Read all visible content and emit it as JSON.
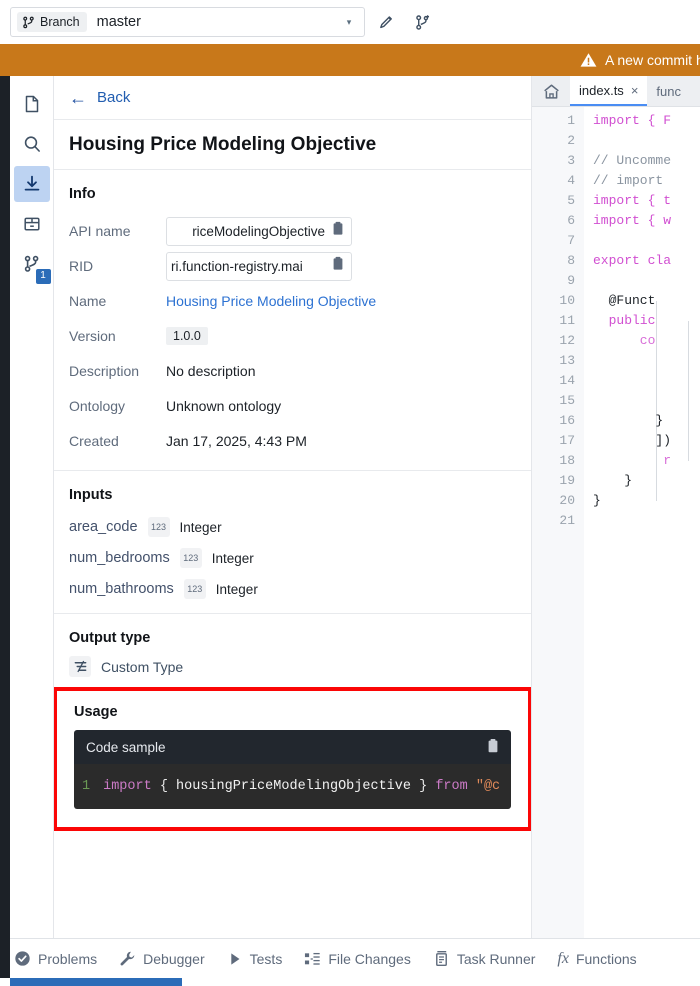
{
  "branch_bar": {
    "chip_label": "Branch",
    "branch_name": "master",
    "caret": "▾",
    "edit_icon": "pencil-icon",
    "new_branch_icon": "branch-plus-icon"
  },
  "banner": {
    "text": "A new commit has be",
    "icon": "warning-icon",
    "color": "#c8781a"
  },
  "sidebar": {
    "items": [
      {
        "name": "files-icon",
        "label": "Files",
        "active": false,
        "badge": ""
      },
      {
        "name": "search-icon",
        "label": "Search",
        "active": false,
        "badge": ""
      },
      {
        "name": "install-icon",
        "label": "Install",
        "active": true,
        "badge": ""
      },
      {
        "name": "package-icon",
        "label": "Package",
        "active": false,
        "badge": ""
      },
      {
        "name": "branches-icon",
        "label": "Branches",
        "active": false,
        "badge": "1"
      }
    ]
  },
  "detail": {
    "back_label": "Back",
    "title": "Housing Price Modeling Objective",
    "info": {
      "heading": "Info",
      "rows": [
        {
          "label": "API name",
          "value": "PriceModelingObjective",
          "type": "copy",
          "display": "riceModelingObjective"
        },
        {
          "label": "RID",
          "value": "ri.function-registry.mai",
          "type": "copy",
          "display": "ri.function-registry.mai"
        },
        {
          "label": "Name",
          "value": "Housing Price Modeling Objective",
          "type": "link"
        },
        {
          "label": "Version",
          "value": "1.0.0",
          "type": "tag"
        },
        {
          "label": "Description",
          "value": "No description",
          "type": "text"
        },
        {
          "label": "Ontology",
          "value": "Unknown ontology",
          "type": "text"
        },
        {
          "label": "Created",
          "value": "Jan 17, 2025, 4:43 PM",
          "type": "text"
        }
      ]
    },
    "inputs": {
      "heading": "Inputs",
      "rows": [
        {
          "name": "area_code",
          "type_icon": "123",
          "type": "Integer"
        },
        {
          "name": "num_bedrooms",
          "type_icon": "123",
          "type": "Integer"
        },
        {
          "name": "num_bathrooms",
          "type_icon": "123",
          "type": "Integer"
        }
      ]
    },
    "output": {
      "heading": "Output type",
      "icon": "custom-type-icon",
      "value": "Custom Type"
    },
    "usage": {
      "heading": "Usage",
      "code_sample_label": "Code sample",
      "copy_icon": "clipboard-icon",
      "line_number": "1",
      "code": {
        "kw_import": "import",
        "brace_open": "{",
        "identifier": "housingPriceModelingObjective",
        "brace_close": "}",
        "kw_from": "from",
        "string": "\"@c"
      },
      "highlight_color": "#fb0606"
    }
  },
  "editor": {
    "home_icon": "home-icon",
    "tabs": [
      {
        "label": "index.ts",
        "active": true,
        "close": "×"
      },
      {
        "label": "func",
        "active": false,
        "close": ""
      }
    ],
    "lines": [
      {
        "n": "1",
        "segments": [
          {
            "t": "import { F",
            "c": "kw"
          }
        ]
      },
      {
        "n": "2",
        "segments": []
      },
      {
        "n": "3",
        "segments": [
          {
            "t": "// Uncomme",
            "c": "cm"
          }
        ]
      },
      {
        "n": "4",
        "segments": [
          {
            "t": "// import",
            "c": "cm"
          }
        ]
      },
      {
        "n": "5",
        "segments": [
          {
            "t": "import { t",
            "c": "kw"
          }
        ]
      },
      {
        "n": "6",
        "segments": [
          {
            "t": "import { w",
            "c": "kw"
          }
        ]
      },
      {
        "n": "7",
        "segments": []
      },
      {
        "n": "8",
        "segments": [
          {
            "t": "export cla",
            "c": "kw"
          }
        ]
      },
      {
        "n": "9",
        "segments": []
      },
      {
        "n": "10",
        "segments": [
          {
            "t": "  @Funct",
            "c": "pl"
          }
        ]
      },
      {
        "n": "11",
        "segments": [
          {
            "t": "  public",
            "c": "kw"
          }
        ]
      },
      {
        "n": "12",
        "segments": [
          {
            "t": "      co",
            "c": "mg"
          }
        ]
      },
      {
        "n": "13",
        "segments": []
      },
      {
        "n": "14",
        "segments": []
      },
      {
        "n": "15",
        "segments": []
      },
      {
        "n": "16",
        "segments": [
          {
            "t": "        }",
            "c": "pl"
          }
        ]
      },
      {
        "n": "17",
        "segments": [
          {
            "t": "        ])",
            "c": "pl"
          }
        ]
      },
      {
        "n": "18",
        "segments": [
          {
            "t": "         r",
            "c": "mg"
          }
        ]
      },
      {
        "n": "19",
        "segments": [
          {
            "t": "    }",
            "c": "pl"
          }
        ]
      },
      {
        "n": "20",
        "segments": [
          {
            "t": "}",
            "c": "pl"
          }
        ]
      },
      {
        "n": "21",
        "segments": []
      }
    ]
  },
  "statusbar": {
    "items": [
      {
        "icon": "check-circle-icon",
        "label": "Problems"
      },
      {
        "icon": "wrench-icon",
        "label": "Debugger"
      },
      {
        "icon": "play-icon",
        "label": "Tests"
      },
      {
        "icon": "file-changes-icon",
        "label": "File Changes"
      },
      {
        "icon": "task-runner-icon",
        "label": "Task Runner"
      },
      {
        "icon": "fx-icon",
        "label": "Functions"
      }
    ]
  }
}
